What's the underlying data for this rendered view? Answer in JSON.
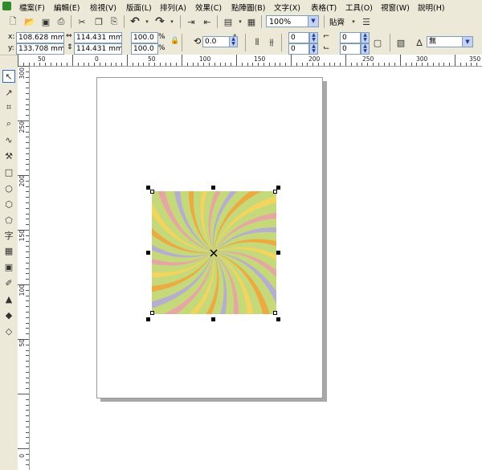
{
  "menu": {
    "items": [
      "檔案(F)",
      "編輯(E)",
      "檢視(V)",
      "版面(L)",
      "排列(A)",
      "效果(C)",
      "點陣圖(B)",
      "文字(X)",
      "表格(T)",
      "工具(O)",
      "視窗(W)",
      "說明(H)"
    ]
  },
  "toolbar": {
    "zoom_value": "100%",
    "snap_label": "貼齊"
  },
  "property_bar": {
    "x_label": "x:",
    "y_label": "y:",
    "x_value": "108.628 mm",
    "y_value": "133.708 mm",
    "width_value": "114.431 mm",
    "height_value": "114.431 mm",
    "scale_x": "100.0",
    "scale_y": "100.0",
    "percent_label": "%",
    "rotation_value": "0.0",
    "degree_label": "°",
    "spin1_top": "0",
    "spin1_bottom": "0",
    "spin2_top": "0",
    "spin2_bottom": "0",
    "outline_value": "無"
  },
  "ruler_top_labels": [
    "50",
    "0",
    "50",
    "100",
    "150",
    "200",
    "250",
    "300",
    "350"
  ],
  "ruler_left_labels": [
    "300",
    "250",
    "200",
    "150",
    "100",
    "50",
    "0"
  ],
  "colors": {
    "ray_green": "#c6d97a",
    "ray_orange": "#f0a43a",
    "ray_yellow": "#f7d35a",
    "ray_pink": "#e9a0a8",
    "ray_purple": "#b4a8d8"
  }
}
